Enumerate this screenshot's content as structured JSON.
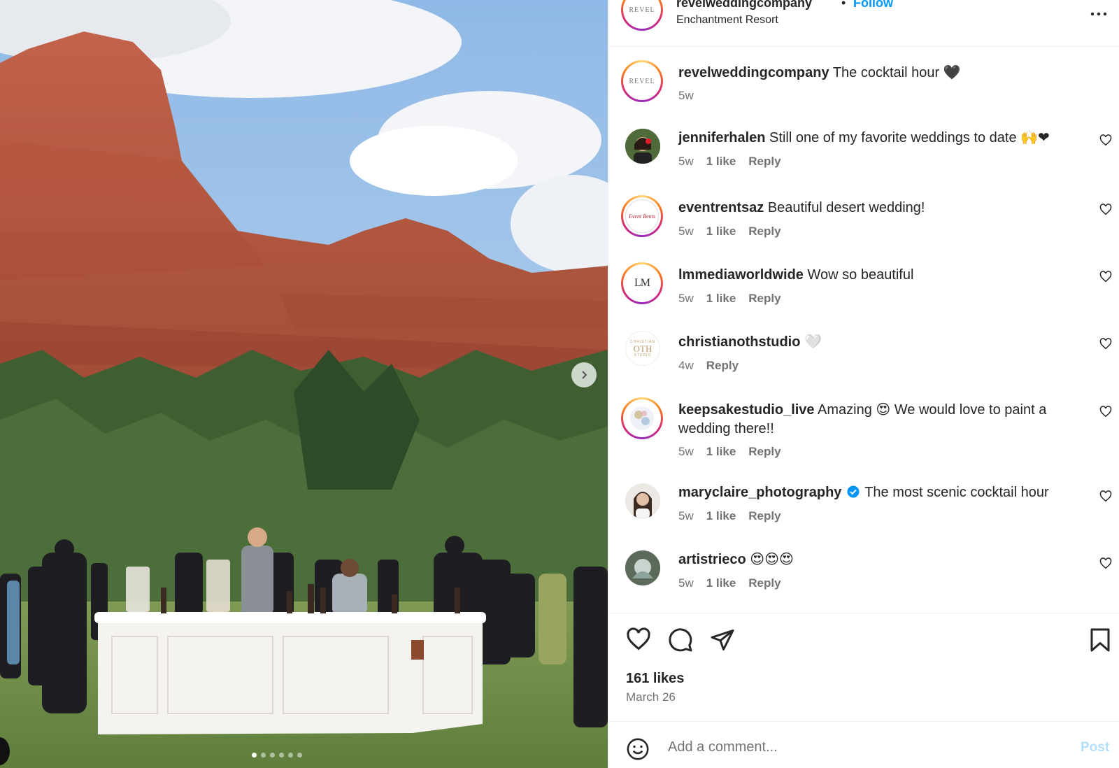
{
  "post": {
    "username": "revelweddingcompany",
    "separator": "•",
    "follow_label": "Follow",
    "location": "Enchantment Resort",
    "more_icon": "more-horizontal-icon",
    "carousel_total": 6,
    "carousel_index": 1
  },
  "caption": {
    "username": "revelweddingcompany",
    "text": "The cocktail hour 🖤",
    "time": "5w"
  },
  "comments": [
    {
      "username": "jenniferhalen",
      "text": "Still one of my favorite weddings to date 🙌❤",
      "time": "5w",
      "likes": "1 like",
      "reply": "Reply"
    },
    {
      "username": "eventrentsaz",
      "text": "Beautiful desert wedding!",
      "time": "5w",
      "likes": "1 like",
      "reply": "Reply"
    },
    {
      "username": "lmmediaworldwide",
      "text": "Wow so beautiful",
      "time": "5w",
      "likes": "1 like",
      "reply": "Reply"
    },
    {
      "username": "christianothstudio",
      "text": "🤍",
      "time": "4w",
      "likes": "",
      "reply": "Reply"
    },
    {
      "username": "keepsakestudio_live",
      "text": "Amazing 😍 We would love to paint a wedding there!!",
      "time": "5w",
      "likes": "1 like",
      "reply": "Reply"
    },
    {
      "username": "maryclaire_photography",
      "text": "The most scenic cocktail hour",
      "time": "5w",
      "likes": "1 like",
      "reply": "Reply",
      "verified": true
    },
    {
      "username": "artistrieco",
      "text": "😍😍😍",
      "time": "5w",
      "likes": "1 like",
      "reply": "Reply"
    }
  ],
  "avatars": {
    "revel": "REVEL",
    "eventrents": "Event Rents",
    "lm": "LM",
    "christian": "CHRISTIAN",
    "christian_oth": "OTH",
    "christian_studio": "STUDIO"
  },
  "stats": {
    "likes": "161 likes",
    "date": "March 26"
  },
  "composer": {
    "placeholder": "Add a comment...",
    "post_label": "Post"
  },
  "colors": {
    "link": "#0095f6",
    "muted": "#737373",
    "post_disabled": "#b2dffc",
    "verified": "#0095f6"
  }
}
